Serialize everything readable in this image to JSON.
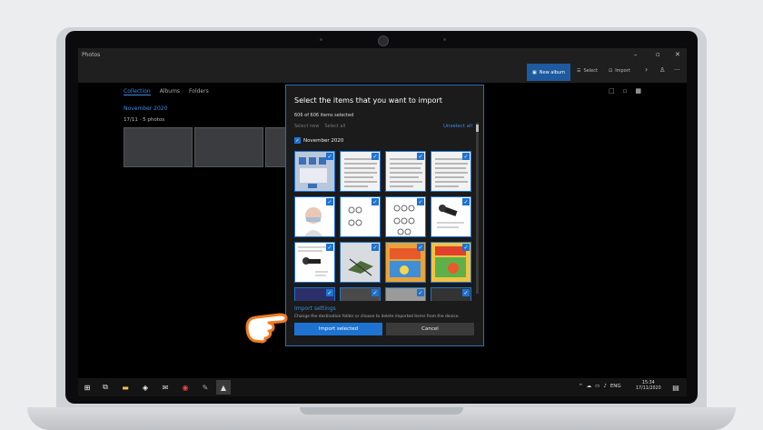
{
  "app": {
    "title": "Photos",
    "window_controls": [
      "–",
      "▫",
      "✕"
    ],
    "toolbar": {
      "new_album": "New album",
      "select": "Select",
      "import": "Import",
      "next_icon": "›",
      "account_icon": "person-icon",
      "more": "···"
    },
    "tabs": [
      "Collection",
      "Albums",
      "Folders"
    ],
    "active_tab": "Collection",
    "collection": {
      "month": "November 2020",
      "date_count": "17/11 · 5 photos"
    }
  },
  "import_dialog": {
    "title": "Select the items that you want to import",
    "selected_count": "606 of 606 items selected",
    "select_new": "Select new",
    "select_all": "Select all",
    "unselect_all": "Unselect all",
    "group_label": "November 2020",
    "settings_title": "Import settings",
    "settings_desc": "Change the destination folder or choose to delete imported items from the device.",
    "import_button": "Import selected",
    "cancel_button": "Cancel",
    "check_glyph": "✓"
  },
  "taskbar": {
    "language": "ENG",
    "time": "15:34",
    "date": "17/11/2020",
    "accent": "#1e73d0"
  }
}
